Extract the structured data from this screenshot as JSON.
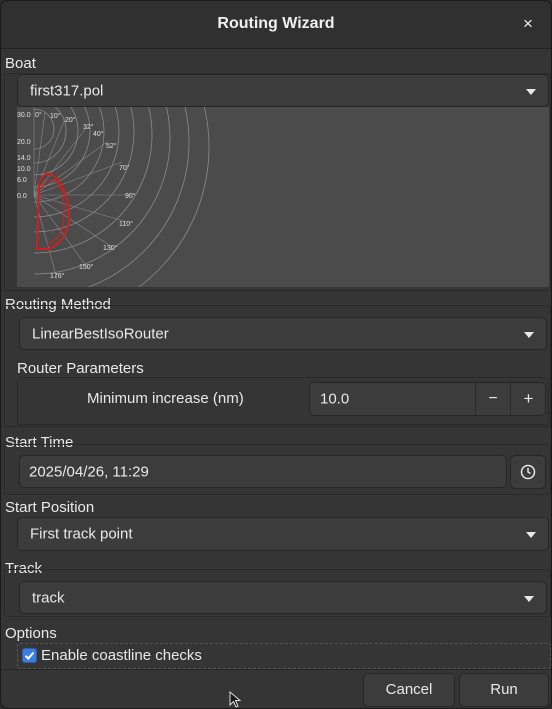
{
  "window": {
    "title": "Routing Wizard",
    "close_glyph": "×"
  },
  "boat": {
    "label": "Boat",
    "selected": "first317.pol",
    "polar": {
      "speed_ticks": [
        "30.0",
        "20.0",
        "14.0",
        "10.0",
        "6.0",
        "0.0"
      ],
      "angle_ticks": [
        "0°",
        "10°",
        "20°",
        "32°",
        "40°",
        "52°",
        "70°",
        "90°",
        "110°",
        "130°",
        "150°",
        "176°"
      ]
    }
  },
  "routing_method": {
    "label": "Routing Method",
    "selected": "LinearBestIsoRouter",
    "params_label": "Router Parameters",
    "min_increase_label": "Minimum increase (nm)",
    "min_increase_value": "10.0",
    "minus_glyph": "−",
    "plus_glyph": "+"
  },
  "start_time": {
    "label": "Start Time",
    "value": "2025/04/26, 11:29"
  },
  "start_position": {
    "label": "Start Position",
    "selected": "First track point"
  },
  "track": {
    "label": "Track",
    "selected": "track"
  },
  "options": {
    "label": "Options",
    "coastline_label": "Enable coastline checks",
    "coastline_checked": true
  },
  "footer": {
    "cancel_label": "Cancel",
    "run_label": "Run"
  },
  "colors": {
    "accent": "#3d7fe0",
    "polar_curve": "#cc2020",
    "background": "#353535"
  }
}
